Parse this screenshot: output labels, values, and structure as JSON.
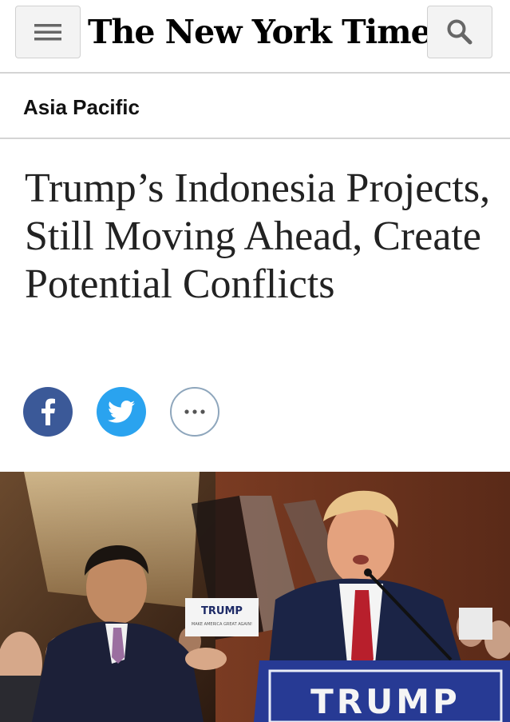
{
  "header": {
    "menu_icon": "hamburger-menu-icon",
    "masthead": "The New York Times",
    "search_icon": "search-icon"
  },
  "section": {
    "label": "Asia Pacific"
  },
  "article": {
    "headline": "Trump’s Indonesia Projects, Still Moving Ahead, Create Potential Conflicts"
  },
  "share": {
    "facebook_icon": "facebook-icon",
    "twitter_icon": "twitter-icon",
    "more_icon": "more-options-icon",
    "colors": {
      "facebook": "#3b5998",
      "twitter": "#2aa3ef",
      "more_border": "#8ea6bc"
    }
  },
  "photo": {
    "podium_sign": "TRUMP",
    "background_sign": "TRUMP",
    "background_sign_subtitle": "MAKE AMERICA GREAT AGAIN!"
  }
}
